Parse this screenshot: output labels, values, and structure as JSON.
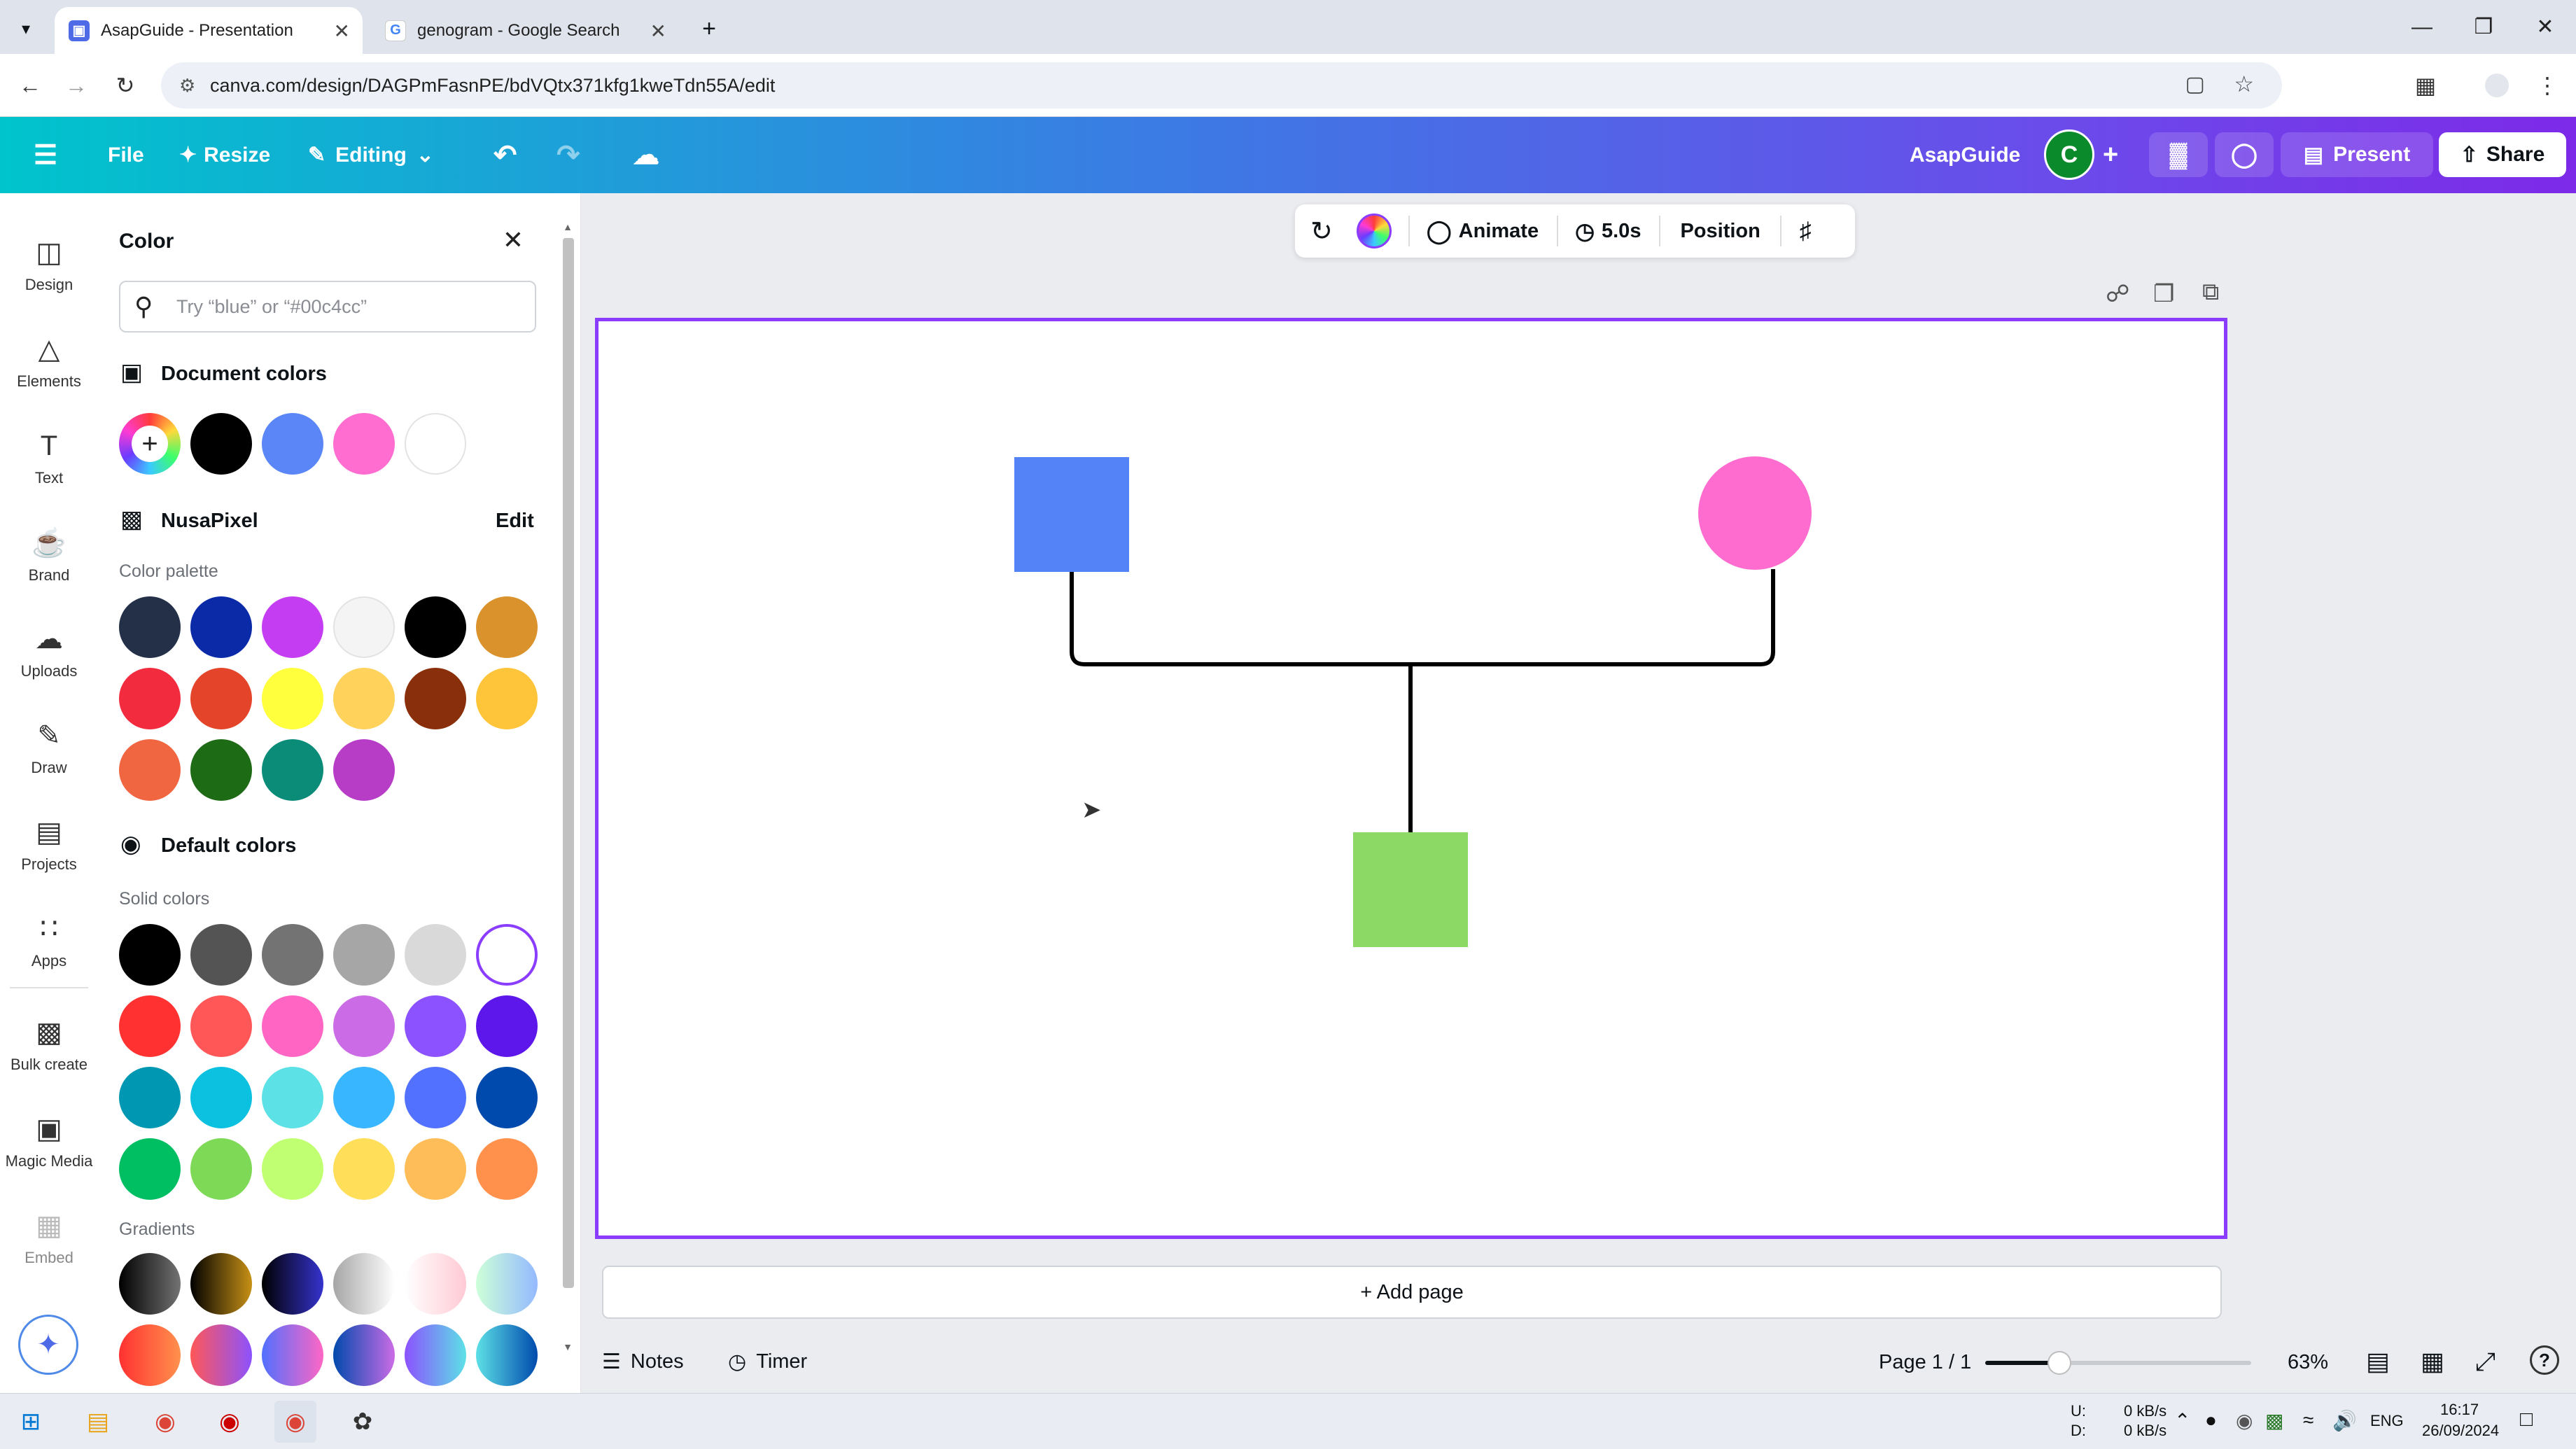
{
  "browser": {
    "tabs": [
      {
        "title": "AsapGuide - Presentation",
        "active": true
      },
      {
        "title": "genogram - Google Search",
        "active": false
      }
    ],
    "url": "canva.com/design/DAGPmFasnPE/bdVQtx371kfg1kweTdn55A/edit"
  },
  "header": {
    "file": "File",
    "resize": "Resize",
    "editing": "Editing",
    "team_name": "AsapGuide",
    "avatar_letter": "C",
    "present": "Present",
    "share": "Share"
  },
  "rail": {
    "items": [
      {
        "label": "Design",
        "icon": "design-icon"
      },
      {
        "label": "Elements",
        "icon": "elements-icon"
      },
      {
        "label": "Text",
        "icon": "text-icon"
      },
      {
        "label": "Brand",
        "icon": "brand-icon"
      },
      {
        "label": "Uploads",
        "icon": "uploads-icon"
      },
      {
        "label": "Draw",
        "icon": "draw-icon"
      },
      {
        "label": "Projects",
        "icon": "projects-icon"
      },
      {
        "label": "Apps",
        "icon": "apps-icon"
      },
      {
        "label": "Bulk create",
        "icon": "bulk-create-icon"
      },
      {
        "label": "Magic Media",
        "icon": "magic-media-icon"
      },
      {
        "label": "Embed",
        "icon": "embed-icon"
      }
    ]
  },
  "panel": {
    "title": "Color",
    "search_placeholder": "Try “blue” or “#00c4cc”",
    "document_colors_title": "Document colors",
    "document_colors": [
      "#000000",
      "#5a86f7",
      "#ff6dd0",
      "#ffffff"
    ],
    "brand_title": "NusaPixel",
    "brand_edit": "Edit",
    "palette_label": "Color palette",
    "palette": [
      "#233047",
      "#0a2aa8",
      "#c43df2",
      "#f4f4f4",
      "#000000",
      "#d9922c",
      "#f22b3f",
      "#e4452a",
      "#ffff3d",
      "#ffd25c",
      "#8a2f0b",
      "#ffc53a",
      "#ef6640",
      "#1d6b14",
      "#0a8c78",
      "#b73dc7"
    ],
    "default_title": "Default colors",
    "solid_label": "Solid colors",
    "solid": [
      "#000000",
      "#545454",
      "#737373",
      "#a6a6a6",
      "#d9d9d9",
      "#ffffff",
      "#ff3131",
      "#ff5757",
      "#ff66c4",
      "#cb6ce6",
      "#8c52ff",
      "#5e17eb",
      "#0097b2",
      "#0cc0df",
      "#5ce1e6",
      "#38b6ff",
      "#5271ff",
      "#004aad",
      "#00bf63",
      "#7ed957",
      "#c1ff72",
      "#ffde59",
      "#ffbd59",
      "#ff914d"
    ],
    "gradients_label": "Gradients",
    "gradients": [
      [
        "#000000",
        "#737373"
      ],
      [
        "#000000",
        "#c89116"
      ],
      [
        "#000000",
        "#3533cd"
      ],
      [
        "#a6a6a6",
        "#ffffff"
      ],
      [
        "#ffffff",
        "#ffcad4"
      ],
      [
        "#cdffd8",
        "#94b9ff"
      ],
      [
        "#ff3131",
        "#ff914d"
      ],
      [
        "#ff5757",
        "#8c52ff"
      ],
      [
        "#5170ff",
        "#ff66c4"
      ],
      [
        "#004aad",
        "#cb6ce6"
      ],
      [
        "#8c52ff",
        "#5ce1e6"
      ],
      [
        "#5de0e6",
        "#004aad"
      ]
    ]
  },
  "context_bar": {
    "animate": "Animate",
    "duration": "5.0s",
    "position": "Position"
  },
  "canvas": {
    "shapes": {
      "square_fill": "#5383f7",
      "circle_fill": "#ff6ccf",
      "child_fill": "#8cd965",
      "line_color": "#000000"
    },
    "add_page": "+ Add page"
  },
  "footer": {
    "notes": "Notes",
    "timer": "Timer",
    "page": "Page 1 / 1",
    "zoom_percent": 63,
    "zoom": "63%"
  },
  "taskbar": {
    "net_up_label": "U:",
    "net_down_label": "D:",
    "net_up": "0 kB/s",
    "net_down": "0 kB/s",
    "lang": "ENG",
    "time": "16:17",
    "date": "26/09/2024"
  }
}
